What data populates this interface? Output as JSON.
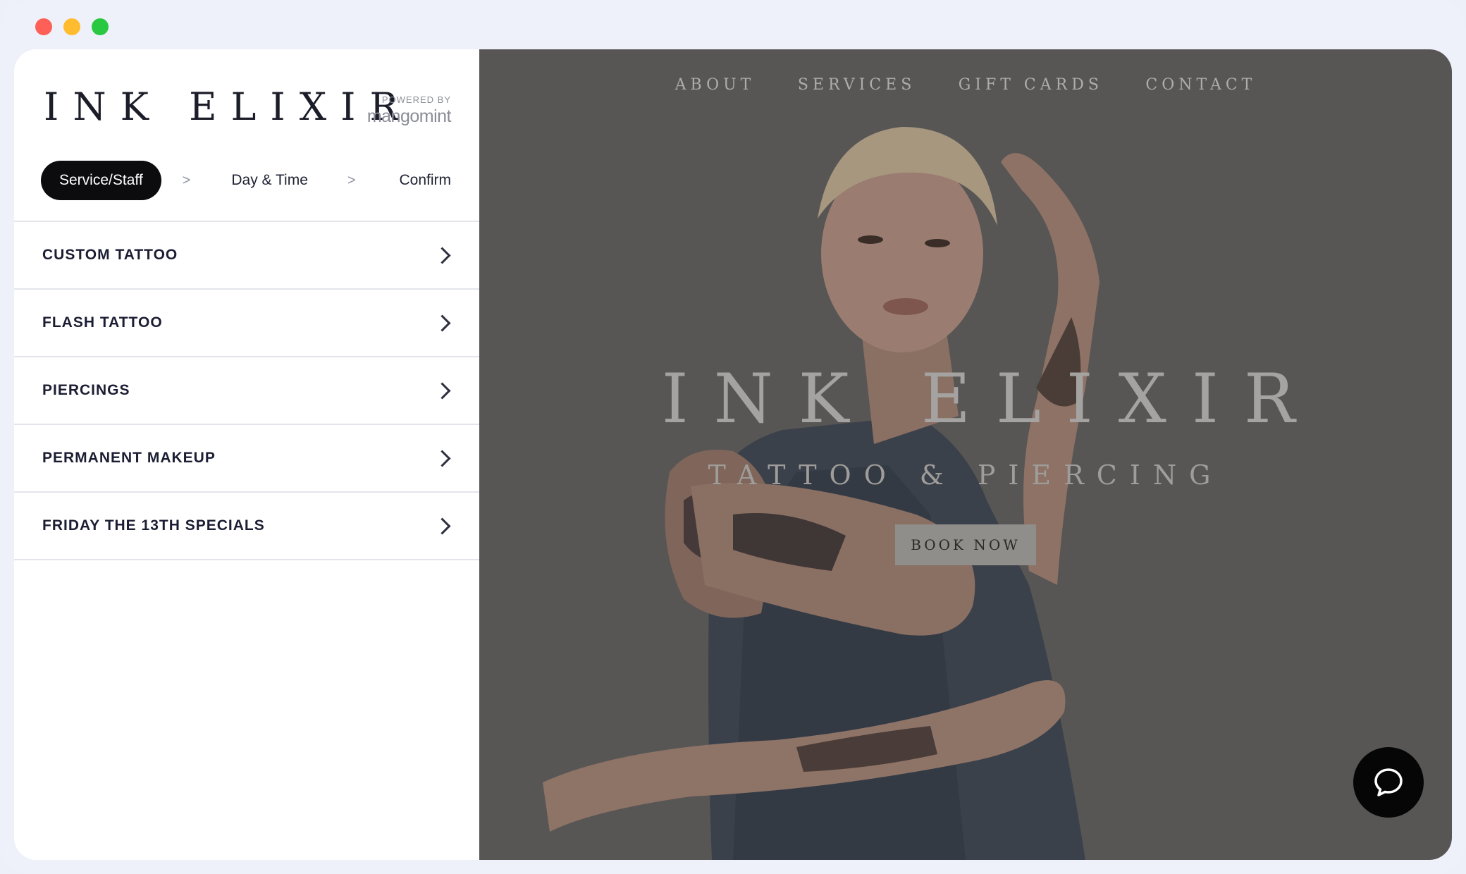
{
  "sidebar": {
    "brand": "INK ELIXIR",
    "powered_by": "POWERED BY",
    "powered_name": "mangomint",
    "steps": {
      "service": "Service/Staff",
      "separator": ">",
      "daytime": "Day & Time",
      "confirm": "Confirm"
    },
    "services": [
      {
        "label": "CUSTOM TATTOO"
      },
      {
        "label": "FLASH TATTOO"
      },
      {
        "label": "PIERCINGS"
      },
      {
        "label": "PERMANENT MAKEUP"
      },
      {
        "label": "FRIDAY THE 13TH SPECIALS"
      }
    ]
  },
  "hero": {
    "nav": [
      {
        "label": "ABOUT"
      },
      {
        "label": "SERVICES"
      },
      {
        "label": "GIFT CARDS"
      },
      {
        "label": "CONTACT"
      }
    ],
    "title": "INK ELIXIR",
    "subtitle": "TATTOO & PIERCING",
    "cta": "BOOK NOW",
    "chat_icon": "chat-bubble-icon"
  },
  "colors": {
    "accent": "#0c0c0f",
    "hero_overlay": "#575655"
  }
}
